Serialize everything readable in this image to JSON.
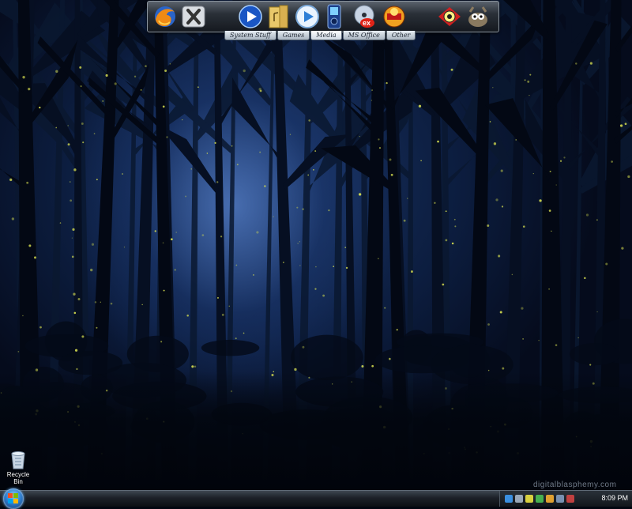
{
  "desktop": {
    "icons": [
      {
        "label": "Recycle Bin",
        "icon": "recycle-bin-icon"
      }
    ],
    "watermark": "digitalblasphemy.com"
  },
  "dock": {
    "icons": [
      {
        "name": "firefox-icon"
      },
      {
        "name": "xfire-icon"
      },
      {
        "name": "media-player-icon"
      },
      {
        "name": "folder-music-icon"
      },
      {
        "name": "play-button-icon"
      },
      {
        "name": "mp3-player-icon"
      },
      {
        "name": "cd-burner-icon"
      },
      {
        "name": "winamp-icon"
      },
      {
        "name": "irfanview-icon"
      },
      {
        "name": "gimp-icon"
      }
    ],
    "tabs": [
      "System Stuff",
      "Games",
      "Media",
      "MS Office",
      "Other"
    ],
    "active_tab": "Media"
  },
  "taskbar": {
    "clock": "8:09 PM",
    "tray_icons": [
      "network-icon",
      "volume-icon",
      "security-icon",
      "messenger-icon",
      "update-icon",
      "power-icon",
      "antivirus-icon"
    ]
  },
  "colors": {
    "accent": "#2f7fd0",
    "firefly": "#d8e050"
  }
}
